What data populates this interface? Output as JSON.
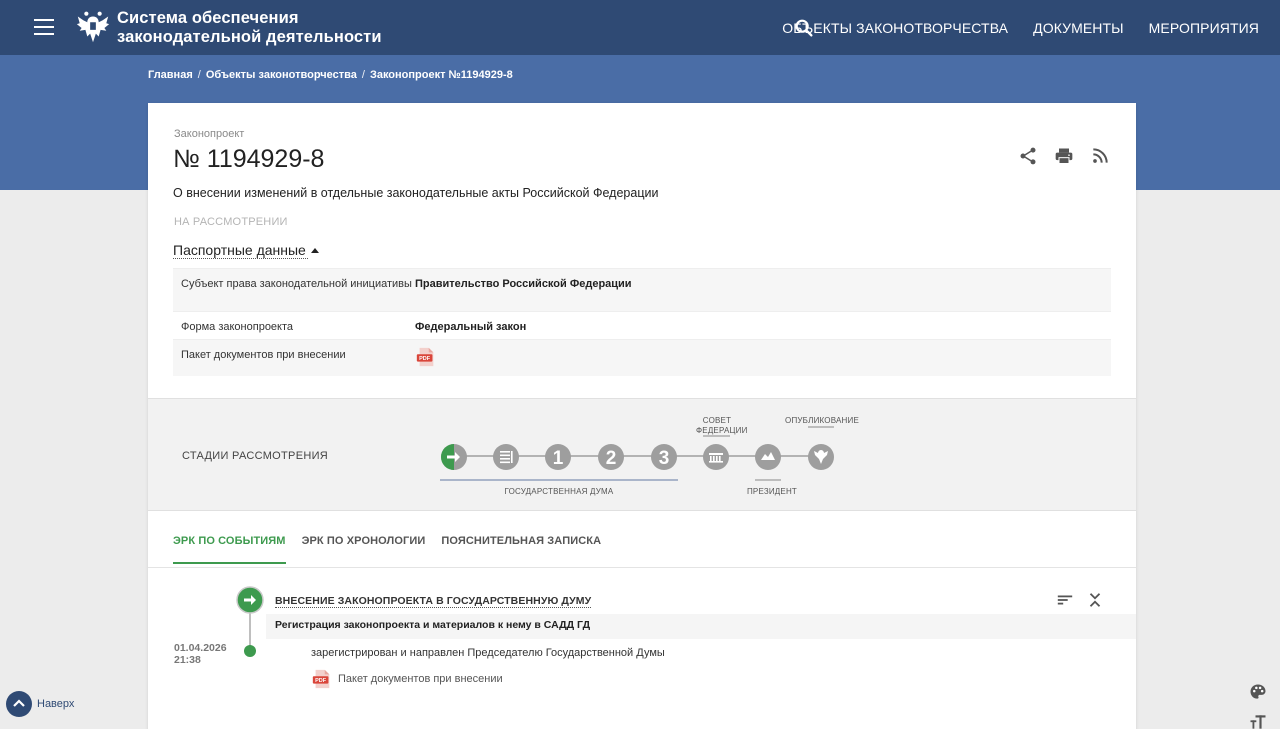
{
  "header": {
    "menu_icon": "hamburger-icon",
    "emblem_icon": "double-headed-eagle-emblem",
    "title_line1": "Система обеспечения",
    "title_line2": "законодательной деятельности",
    "search_icon": "search-icon",
    "nav": [
      "ОБЪЕКТЫ ЗАКОНОТВОРЧЕСТВА",
      "ДОКУМЕНТЫ",
      "МЕРОПРИЯТИЯ"
    ]
  },
  "breadcrumb": [
    "Главная",
    "Объекты законотворчества",
    "Законопроект №1194929-8"
  ],
  "bill": {
    "kind": "Законопроект",
    "number": "№ 1194929-8",
    "title": "О внесении изменений в отдельные законодательные акты Российской Федерации",
    "status": "НА РАССМОТРЕНИИ",
    "tools": [
      "share-icon",
      "print-icon",
      "rss-icon"
    ]
  },
  "passport": {
    "toggle_label": "Паспортные данные",
    "rows": [
      {
        "key": "Субъект права законодательной инициативы",
        "value": "Правительство Российской Федерации"
      },
      {
        "key": "Форма законопроекта",
        "value": "Федеральный закон"
      },
      {
        "key": "Пакет документов при внесении",
        "value": "",
        "icon": "pdf-icon"
      }
    ]
  },
  "stages": {
    "label": "СТАДИИ РАССМОТРЕНИЯ",
    "items": [
      {
        "icon": "arrow-right-icon",
        "state": "current"
      },
      {
        "icon": "document-list-icon",
        "state": "pending"
      },
      {
        "text": "1",
        "state": "pending"
      },
      {
        "text": "2",
        "state": "pending"
      },
      {
        "text": "3",
        "state": "pending"
      },
      {
        "icon": "council-building-icon",
        "state": "pending"
      },
      {
        "icon": "president-icon",
        "state": "pending"
      },
      {
        "icon": "eagle-icon",
        "state": "pending"
      }
    ],
    "captions": {
      "duma": "ГОСУДАРСТВЕННАЯ ДУМА",
      "council_line1": "СОВЕТ",
      "council_line2": "ФЕДЕРАЦИИ",
      "president": "ПРЕЗИДЕНТ",
      "published": "ОПУБЛИКОВАНИЕ"
    },
    "colors": {
      "current": "#3d9a4e",
      "pending": "#9e9e9e"
    }
  },
  "tabs": [
    "ЭРК ПО СОБЫТИЯМ",
    "ЭРК ПО ХРОНОЛОГИИ",
    "ПОЯСНИТЕЛЬНАЯ ЗАПИСКА"
  ],
  "events": {
    "title": "ВНЕСЕНИЕ ЗАКОНОПРОЕКТА В ГОСУДАРСТВЕННУЮ ДУМУ",
    "subtitle": "Регистрация законопроекта и материалов к нему в САДД ГД",
    "date": "01.04.2026",
    "time": "21:38",
    "description": "зарегистрирован и направлен Председателю Государственной Думы",
    "doc_label": "Пакет документов при внесении",
    "tools": [
      "sort-icon",
      "collapse-icon"
    ]
  },
  "floating": {
    "up_label": "Наверх",
    "right_tools": [
      "palette-icon",
      "font-size-icon"
    ]
  },
  "colors": {
    "navbar": "#2f4a74",
    "band": "#4a6da6",
    "accent": "#3d9a4e"
  }
}
